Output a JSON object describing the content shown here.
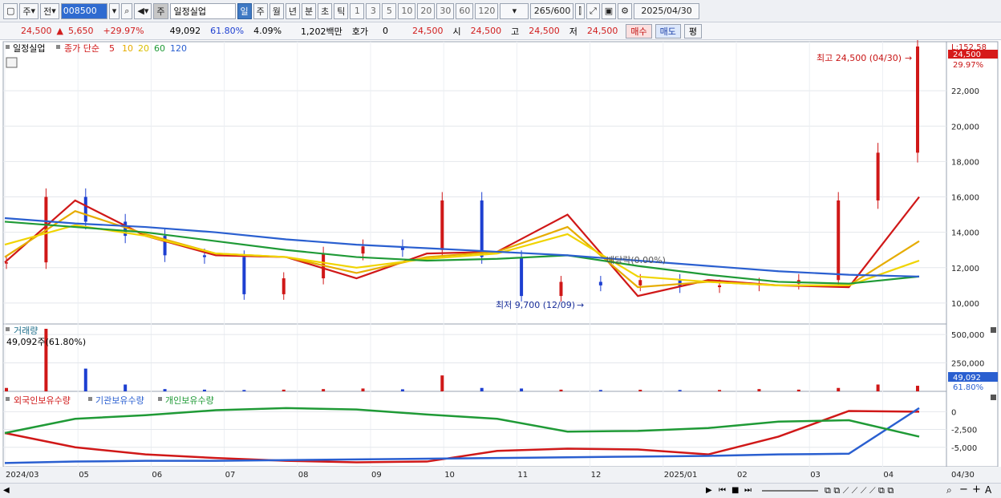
{
  "toolbar": {
    "market": "주",
    "prev_label": "전",
    "code": "008500",
    "stock_prefix": "주",
    "stock_name": "일정실업",
    "periods": [
      "일",
      "주",
      "월",
      "년",
      "분",
      "초",
      "틱"
    ],
    "minutes": [
      "1",
      "3",
      "5",
      "10",
      "20",
      "30",
      "60",
      "120"
    ],
    "count": "265",
    "total": "/600",
    "date": "2025/04/30"
  },
  "quote": {
    "price": "24,500",
    "change": "5,650",
    "change_pct": "+29.97%",
    "volume": "49,092",
    "vol_ratio": "61.80%",
    "turnover": "4.09%",
    "amount": "1,202백만",
    "hoga_label": "호가",
    "hoga_value": "0",
    "hoga_price": "24,500",
    "open_label": "시",
    "open": "24,500",
    "high_label": "고",
    "high": "24,500",
    "low_label": "저",
    "low": "24,500",
    "buy": "매수",
    "sell": "매도",
    "eval": "평"
  },
  "price_panel": {
    "legend_name": "일정실업",
    "legend_ma_label": "종가 단순",
    "legend_ma": [
      "5",
      "10",
      "20",
      "60",
      "120"
    ],
    "legend_colors": [
      "#d01818",
      "#e6ac00",
      "#f0d400",
      "#1f9a36",
      "#2a5fd0"
    ],
    "high_label": "최고 24,500 (04/30)",
    "low_label": "최저 9,700 (12/09)",
    "event_label": "배당락(0.00%)",
    "last_badge": "24,500",
    "top_right_label": "L:152.58",
    "pct_label": "29.97%"
  },
  "volume_panel": {
    "title": "거래량",
    "value_label": "49,092주(61.80%)",
    "badge": "49,092",
    "pct_badge": "61.80%"
  },
  "holding_panel": {
    "series_labels": [
      "외국인보유수량",
      "기관보유수량",
      "개인보유수량"
    ]
  },
  "x_axis": {
    "labels": [
      "2024/03",
      "05",
      "06",
      "07",
      "08",
      "09",
      "10",
      "11",
      "12",
      "2025/01",
      "02",
      "03",
      "04"
    ],
    "last": "04/30"
  },
  "chart_data": [
    {
      "type": "line",
      "title": "",
      "y_ticks": [
        "22,000",
        "20,000",
        "18,000",
        "16,000",
        "14,000",
        "12,000",
        "10,000"
      ],
      "y_range": [
        9000,
        24500
      ],
      "x": [
        "2024/03",
        "05",
        "06",
        "07",
        "08",
        "09",
        "10",
        "11",
        "12",
        "2025/01",
        "02",
        "03",
        "04",
        "04/30"
      ],
      "series": [
        {
          "name": "5",
          "color": "#d01818",
          "values": [
            12300,
            15800,
            13800,
            12700,
            12600,
            11400,
            12800,
            12900,
            15000,
            10400,
            11300,
            11000,
            10900,
            16000
          ]
        },
        {
          "name": "10",
          "color": "#e6ac00",
          "values": [
            12600,
            15200,
            13900,
            12800,
            12600,
            11700,
            12600,
            12900,
            14300,
            10900,
            11200,
            11000,
            11000,
            13500
          ]
        },
        {
          "name": "20",
          "color": "#f0d400",
          "values": [
            13300,
            14400,
            13800,
            12800,
            12600,
            12000,
            12500,
            12800,
            13900,
            11500,
            11200,
            11000,
            11000,
            12400
          ]
        },
        {
          "name": "60",
          "color": "#1f9a36",
          "values": [
            14600,
            14300,
            14000,
            13500,
            13000,
            12600,
            12400,
            12500,
            12700,
            12100,
            11600,
            11200,
            11100,
            11500
          ]
        },
        {
          "name": "120",
          "color": "#2a5fd0",
          "values": [
            14800,
            14500,
            14300,
            14000,
            13600,
            13300,
            13100,
            12900,
            12700,
            12400,
            12100,
            11800,
            11600,
            11500
          ]
        }
      ],
      "candles_close": [
        12300,
        16000,
        14600,
        13800,
        12700,
        12600,
        10500,
        11400,
        12800,
        13200,
        13000,
        15800,
        12600,
        10400,
        11200,
        11000,
        11300,
        10900,
        11000,
        11100,
        11300,
        15800,
        18500,
        24500
      ]
    },
    {
      "type": "bar",
      "title": "거래량",
      "y_ticks": [
        "500,000",
        "250,000"
      ],
      "y_range": [
        0,
        550000
      ],
      "values": [
        30000,
        580000,
        200000,
        60000,
        20000,
        15000,
        12000,
        15000,
        20000,
        25000,
        18000,
        140000,
        30000,
        25000,
        15000,
        12000,
        14000,
        12000,
        12000,
        20000,
        15000,
        30000,
        60000,
        49092
      ]
    },
    {
      "type": "line",
      "title": "외국인보유수량 / 기관보유수량 / 개인보유수량",
      "y_ticks": [
        "0",
        "-2,500",
        "-5,000"
      ],
      "y_range": [
        -7500,
        1500
      ],
      "x": [
        "2024/03",
        "05",
        "06",
        "07",
        "08",
        "09",
        "10",
        "11",
        "12",
        "2025/01",
        "02",
        "03",
        "04",
        "04/30"
      ],
      "series": [
        {
          "name": "외국인보유수량",
          "color": "#d01818",
          "values": [
            -3000,
            -5000,
            -6000,
            -6500,
            -6900,
            -7100,
            -7000,
            -5500,
            -5200,
            -5300,
            -6000,
            -3500,
            100,
            0
          ]
        },
        {
          "name": "기관보유수량",
          "color": "#2a5fd0",
          "values": [
            -7200,
            -7000,
            -6900,
            -6900,
            -6800,
            -6700,
            -6600,
            -6500,
            -6400,
            -6300,
            -6200,
            -6000,
            -5900,
            500
          ]
        },
        {
          "name": "개인보유수량",
          "color": "#1f9a36",
          "values": [
            -3000,
            -1000,
            -500,
            200,
            500,
            300,
            -400,
            -1000,
            -2800,
            -2700,
            -2300,
            -1400,
            -1200,
            -3500
          ]
        }
      ]
    }
  ]
}
